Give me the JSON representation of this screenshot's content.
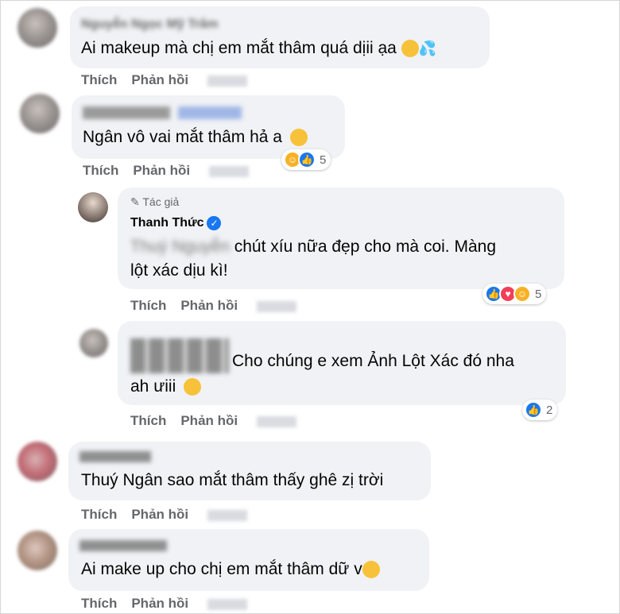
{
  "comments": [
    {
      "name": "Nguyễn Ngọc Mỹ Trâm",
      "text": "Ai makeup mà chị em mắt thâm quá dịii ạa",
      "actions": [
        "Thích",
        "Phản hồi"
      ]
    },
    {
      "name": "",
      "text": "Ngân vô vai mắt thâm hả a",
      "actions": [
        "Thích",
        "Phản hồi"
      ],
      "reaction_count": "5"
    },
    {
      "author_tag": "Tác giả",
      "name": "Thanh Thức",
      "text_line1": "chút xíu nữa đẹp cho mà coi. Màng",
      "text_line2": "lột xác dịu kì!",
      "actions": [
        "Thích",
        "Phản hồi"
      ],
      "reaction_count": "5"
    },
    {
      "name": "",
      "text_line1": "Cho chúng e xem Ảnh Lột Xác đó nha",
      "text_line2": "ah ưiii",
      "actions": [
        "Thích",
        "Phản hồi"
      ],
      "reaction_count": "2"
    },
    {
      "name": "",
      "text": "Thuý Ngân sao mắt thâm thấy ghê zị trời",
      "actions": [
        "Thích",
        "Phản hồi"
      ]
    },
    {
      "name": "",
      "text": "Ai make up cho chị em mắt thâm dữ v",
      "actions": [
        "Thích",
        "Phản hồi"
      ]
    }
  ],
  "colors": {
    "bubble": "#f0f2f5",
    "action": "#65676b",
    "like": "#1877f2",
    "love": "#f33e58",
    "emoji": "#f7c23a"
  }
}
